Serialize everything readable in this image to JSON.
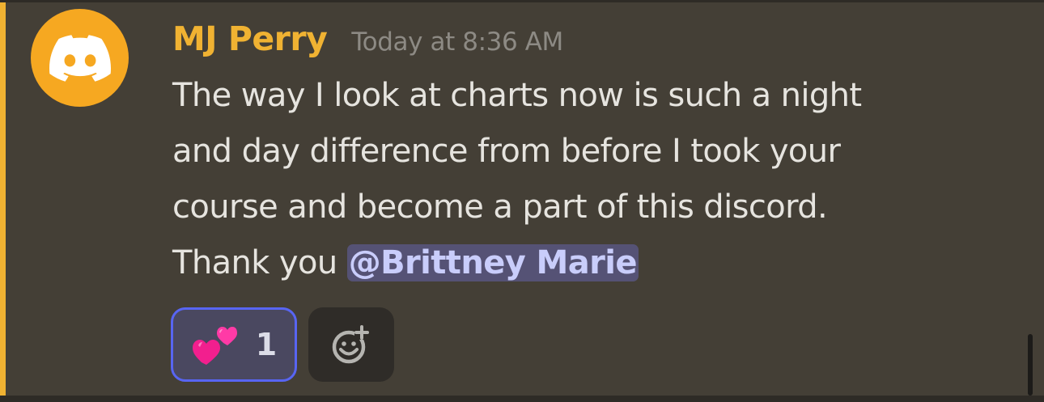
{
  "message": {
    "author": "MJ Perry",
    "timestamp": "Today at 8:36 AM",
    "avatar_icon": "discord-logo-icon",
    "lines": [
      "The way I look at charts now is such a night",
      "and day difference from before I took your",
      "course and become a part of this discord."
    ],
    "last_line_prefix": "Thank you ",
    "mention": "@Brittney Marie"
  },
  "reactions": [
    {
      "emoji": "two-hearts-icon",
      "count": "1"
    }
  ],
  "add_reaction_icon": "add-reaction-icon",
  "colors": {
    "author": "#f0b232",
    "mention_bar": "#f0b232",
    "avatar_bg": "#f6a821",
    "mention_bg": "#555275",
    "mention_text": "#c9cdfb",
    "reaction_border": "#5865f2",
    "background": "#443f36"
  }
}
